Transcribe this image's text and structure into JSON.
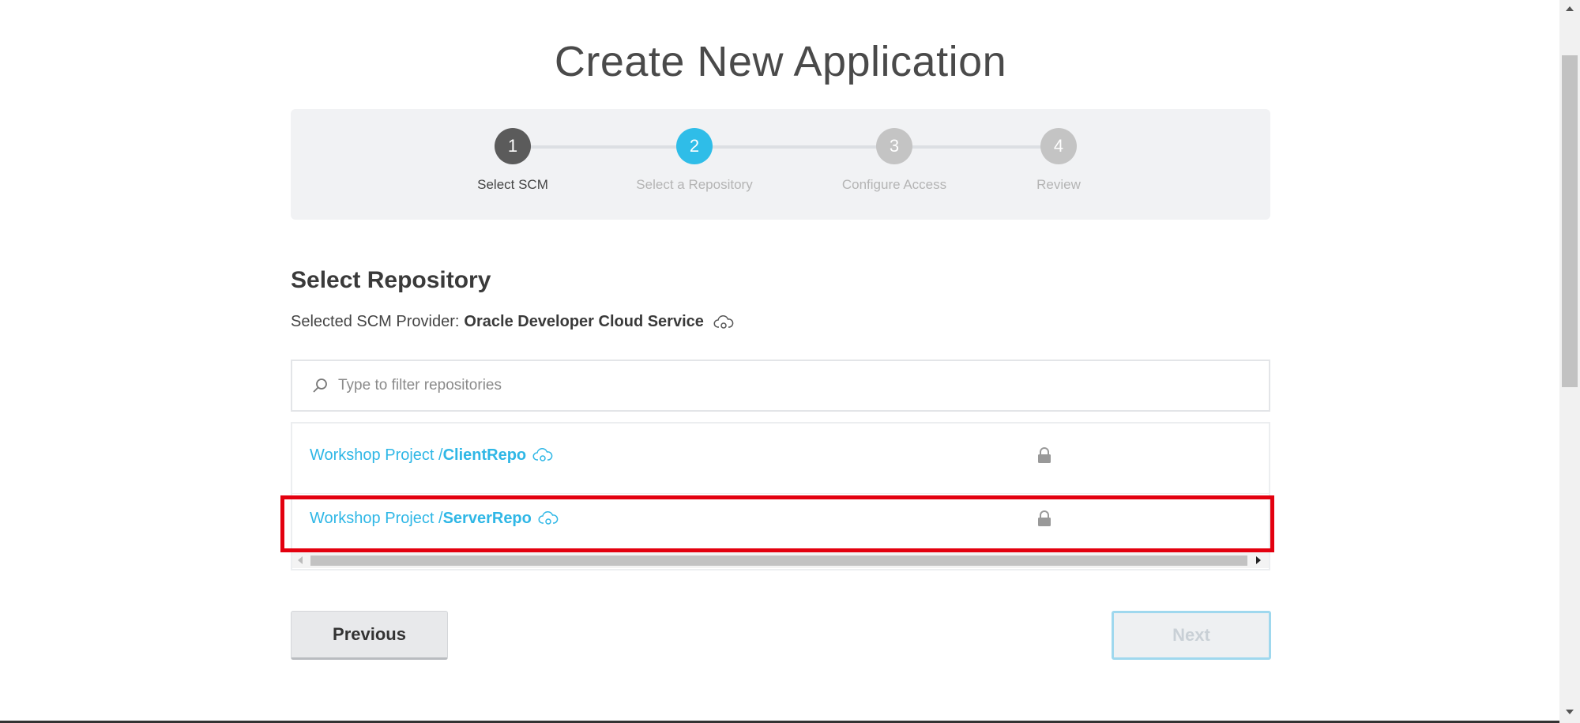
{
  "page": {
    "title": "Create New Application"
  },
  "steps": [
    {
      "number": "1",
      "label": "Select SCM",
      "state": "done",
      "color": "#5b5b5b",
      "label_color": "#444444"
    },
    {
      "number": "2",
      "label": "Select a Repository",
      "state": "current",
      "color": "#2fbde8",
      "label_color": "#b4b4b4"
    },
    {
      "number": "3",
      "label": "Configure Access",
      "state": "pending",
      "color": "#c4c4c4",
      "label_color": "#b4b4b4"
    },
    {
      "number": "4",
      "label": "Review",
      "state": "pending",
      "color": "#c4c4c4",
      "label_color": "#b4b4b4"
    }
  ],
  "section": {
    "title": "Select Repository",
    "provider_label": "Selected SCM Provider:",
    "provider_name": "Oracle Developer Cloud Service",
    "provider_icon": "cloud-icon"
  },
  "filter": {
    "placeholder": "Type to filter repositories",
    "value": "",
    "icon": "search-icon"
  },
  "repositories": [
    {
      "project": "Workshop Project /",
      "name": "ClientRepo",
      "icon": "cloud-icon",
      "private": true,
      "lock_icon": "lock-icon"
    },
    {
      "project": "Workshop Project /",
      "name": "ServerRepo",
      "icon": "cloud-icon",
      "private": true,
      "lock_icon": "lock-icon",
      "highlighted": true
    }
  ],
  "buttons": {
    "previous": "Previous",
    "next": "Next",
    "next_enabled": false
  },
  "colors": {
    "accent": "#2fb7e6",
    "highlight": "#e3000f",
    "step_done": "#5b5b5b",
    "step_pending": "#c4c4c4"
  }
}
